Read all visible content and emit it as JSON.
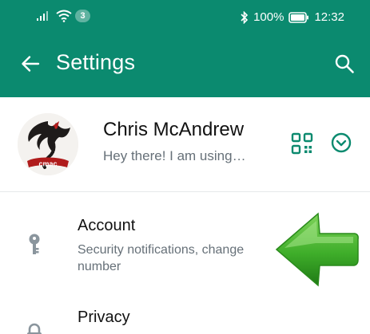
{
  "status_bar": {
    "badge": "3",
    "battery": "100%",
    "time": "12:32"
  },
  "toolbar": {
    "title": "Settings",
    "back_icon": "arrow-back-icon",
    "search_icon": "search-icon"
  },
  "profile": {
    "name": "Chris McAndrew",
    "status": "Hey there! I am using…",
    "avatar_text": "cmac",
    "qr_icon": "qr-code-icon",
    "expand_icon": "chevron-down-circle-icon"
  },
  "settings": [
    {
      "title": "Account",
      "subtitle": "Security notifications, change number",
      "icon": "key-icon"
    },
    {
      "title": "Privacy",
      "subtitle": "",
      "icon": "lock-icon"
    }
  ],
  "colors": {
    "header": "#0b8a6f",
    "accent": "#0b8a6f",
    "arrow": "#3fae2a"
  }
}
